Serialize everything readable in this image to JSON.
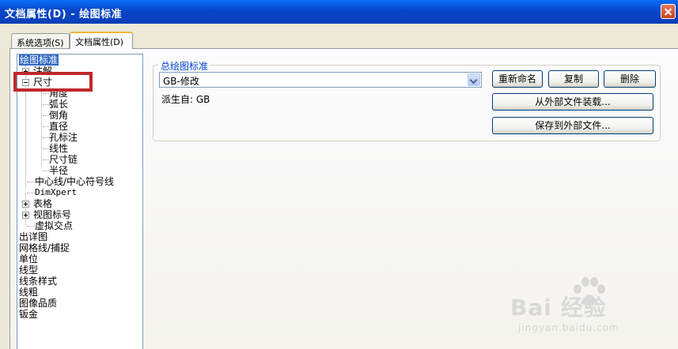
{
  "window": {
    "title": "文档属性(D) - 绘图标准"
  },
  "tabs": [
    {
      "label": "系统选项(S)"
    },
    {
      "label": "文档属性(D)"
    }
  ],
  "tree": {
    "items": [
      {
        "label": "绘图标准"
      },
      {
        "label": "注解"
      },
      {
        "label": "尺寸"
      },
      {
        "label": "角度"
      },
      {
        "label": "弧长"
      },
      {
        "label": "倒角"
      },
      {
        "label": "直径"
      },
      {
        "label": "孔标注"
      },
      {
        "label": "线性"
      },
      {
        "label": "尺寸链"
      },
      {
        "label": "半径"
      },
      {
        "label": "中心线/中心符号线"
      },
      {
        "label": "DimXpert"
      },
      {
        "label": "表格"
      },
      {
        "label": "视图标号"
      },
      {
        "label": "虚拟交点"
      },
      {
        "label": "出详图"
      },
      {
        "label": "网格线/捕捉"
      },
      {
        "label": "单位"
      },
      {
        "label": "线型"
      },
      {
        "label": "线条样式"
      },
      {
        "label": "线粗"
      },
      {
        "label": "图像品质"
      },
      {
        "label": "钣金"
      }
    ]
  },
  "standard": {
    "group_title": "总绘图标准",
    "selected": "GB-修改",
    "derived_from": "派生自: GB"
  },
  "buttons": {
    "rename": "重新命名",
    "copy": "复制",
    "delete": "删除",
    "load": "从外部文件装载...",
    "save": "保存到外部文件..."
  },
  "watermark": {
    "brand": "Bai 经验",
    "url": "jingyan.baidu.com"
  },
  "colors": {
    "selection": "#316ac5",
    "highlight_box": "#c0282a",
    "group_title": "#0046d5"
  }
}
